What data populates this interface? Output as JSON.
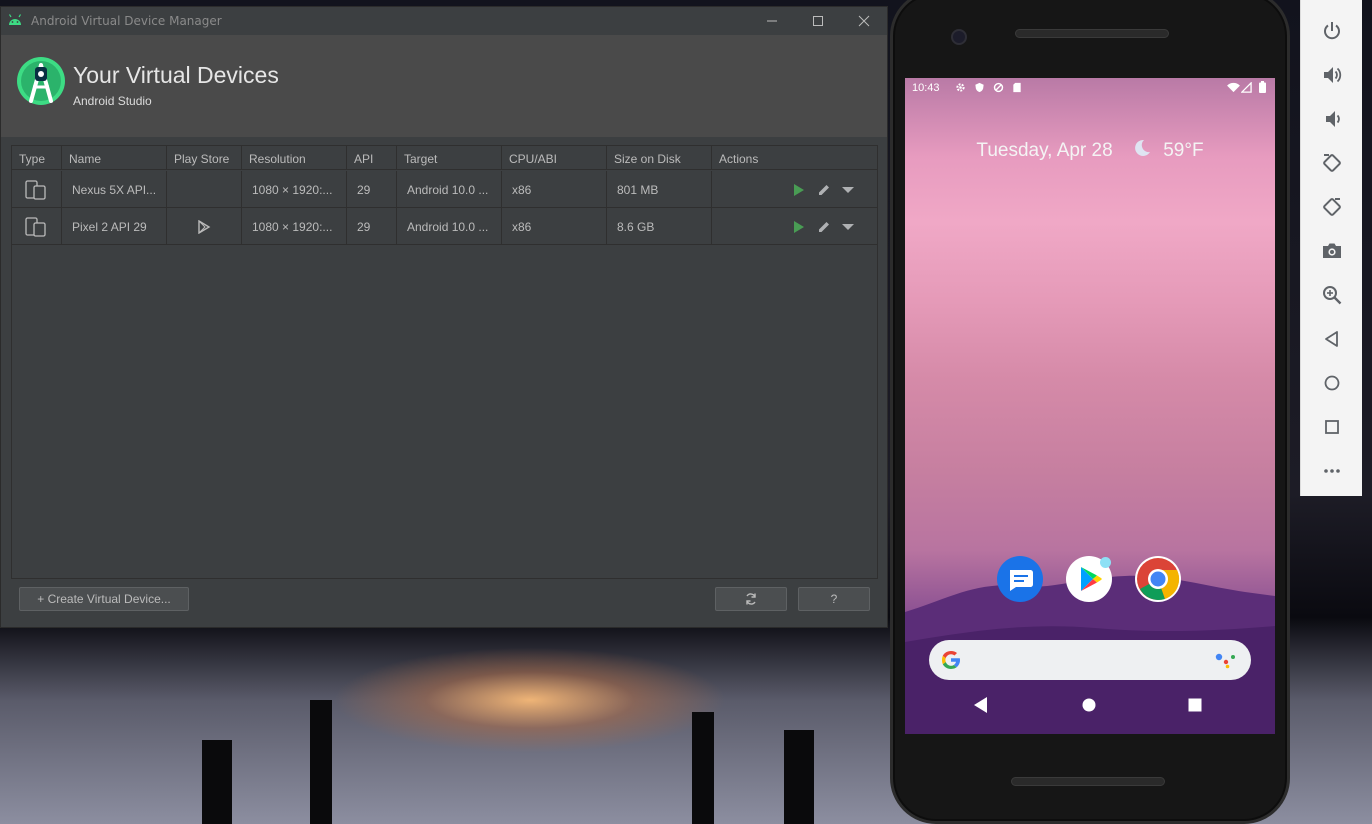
{
  "avd_window": {
    "title": "Android Virtual Device Manager",
    "header_title": "Your Virtual Devices",
    "header_subtitle": "Android Studio",
    "columns": [
      "Type",
      "Name",
      "Play Store",
      "Resolution",
      "API",
      "Target",
      "CPU/ABI",
      "Size on Disk",
      "Actions"
    ],
    "rows": [
      {
        "name": "Nexus 5X API...",
        "play_store": false,
        "resolution": "1080 × 1920:...",
        "api": "29",
        "target": "Android 10.0 ...",
        "cpu": "x86",
        "size": "801 MB"
      },
      {
        "name": "Pixel 2 API 29",
        "play_store": true,
        "resolution": "1080 × 1920:...",
        "api": "29",
        "target": "Android 10.0 ...",
        "cpu": "x86",
        "size": "8.6 GB"
      }
    ],
    "create_button": "+ Create Virtual Device...",
    "refresh_icon": "refresh-icon",
    "help_button": "?"
  },
  "emulator": {
    "status_time": "10:43",
    "date": "Tuesday, Apr 28",
    "weather_icon": "moon-icon",
    "temperature": "59°F",
    "apps": [
      "messages-icon",
      "play-store-icon",
      "chrome-icon"
    ],
    "toolbar_icons": [
      "power-icon",
      "volume-up-icon",
      "volume-down-icon",
      "rotate-left-icon",
      "rotate-right-icon",
      "camera-icon",
      "zoom-icon",
      "back-icon",
      "home-icon",
      "overview-icon",
      "more-icon"
    ]
  },
  "colors": {
    "window_bg": "#3c3f41",
    "header_bg": "#4a4a4a",
    "accent_green": "#3ddc84",
    "run_green": "#499c54"
  }
}
